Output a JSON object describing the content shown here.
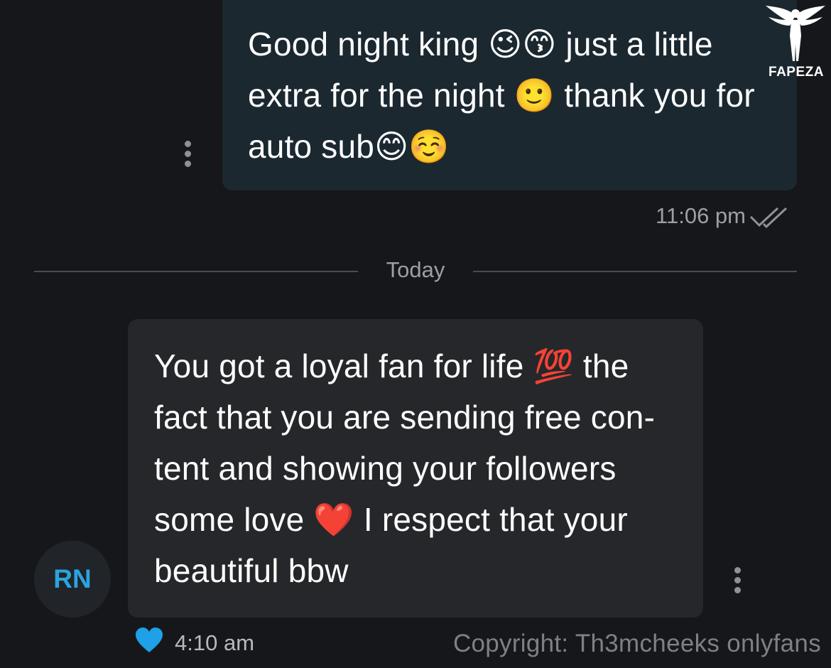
{
  "outgoing_message": {
    "text": "Good night king 😉😙 just a little extra for the night 🙂 thank you for auto sub😊☺️",
    "time": "11:06 pm",
    "status_icon": "double-check-icon"
  },
  "date_divider": {
    "label": "Today"
  },
  "incoming_message": {
    "text": "You got a loyal fan for life 💯 the fact that you are sending free con- tent and showing your followers some love ❤️ I respect that your beautiful bbw",
    "time": "4:10 am",
    "reaction_icon": "heart-icon"
  },
  "sender": {
    "initials": "RN"
  },
  "watermark": {
    "text": "FAPEZA",
    "copyright": "Copyright: Th3mcheeks onlyfans"
  },
  "colors": {
    "background": "#16171a",
    "outgoing_bubble": "#1b2830",
    "incoming_bubble": "#26272a",
    "accent": "#2aa4e0",
    "muted_text": "#9ba0a6"
  }
}
